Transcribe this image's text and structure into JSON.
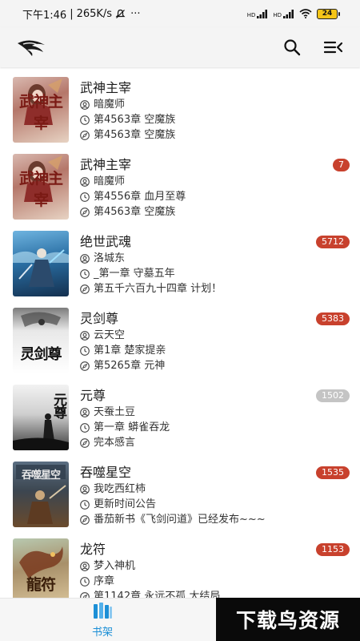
{
  "status_bar": {
    "time": "下午1:46",
    "speed": "265K/s",
    "more": "···",
    "network_left": "HD",
    "network_right": "HD",
    "battery": "24"
  },
  "app_bar": {
    "logo": "app-logo",
    "icons": [
      "search-icon",
      "sort-menu-icon"
    ]
  },
  "books": [
    {
      "title": "武神主宰",
      "author": "暗魔师",
      "last_read": "第4563章 空魔族",
      "latest": "第4563章 空魔族",
      "badge": "",
      "cover_text": "武神主宰"
    },
    {
      "title": "武神主宰",
      "author": "暗魔师",
      "last_read": "第4556章 血月至尊",
      "latest": "第4563章 空魔族",
      "badge": "7",
      "cover_text": "武神主宰"
    },
    {
      "title": "绝世武魂",
      "author": "洛城东",
      "last_read": "_第一章 守墓五年",
      "latest": "第五千六百九十四章 计划！",
      "badge": "5712",
      "cover_text": ""
    },
    {
      "title": "灵剑尊",
      "author": "云天空",
      "last_read": "第1章 楚家提亲",
      "latest": "第5265章 元神",
      "badge": "5383",
      "cover_text": "灵剑尊"
    },
    {
      "title": "元尊",
      "author": "天蚕土豆",
      "last_read": "第一章 蟒雀吞龙",
      "latest": "完本感言",
      "badge": "1502",
      "cover_text": "元尊"
    },
    {
      "title": "吞噬星空",
      "author": "我吃西红柿",
      "last_read": "更新时间公告",
      "latest": "番茄新书《飞剑问道》已经发布~~~",
      "badge": "1535",
      "cover_text": "吞噬星空"
    },
    {
      "title": "龙符",
      "author": "梦入神机",
      "last_read": "序章",
      "latest": "第1142章 永远不孤 大结局",
      "badge": "1153",
      "cover_text": "龍符"
    }
  ],
  "colors": {
    "badge_red": "#c8412d",
    "badge_grey": "#c4c4c4",
    "nav_blue": "#1c8fd6"
  },
  "bottom_nav": {
    "bookshelf_label": "书架",
    "icon": "bookshelf-icon"
  },
  "watermark": {
    "text": "下载鸟资源"
  }
}
